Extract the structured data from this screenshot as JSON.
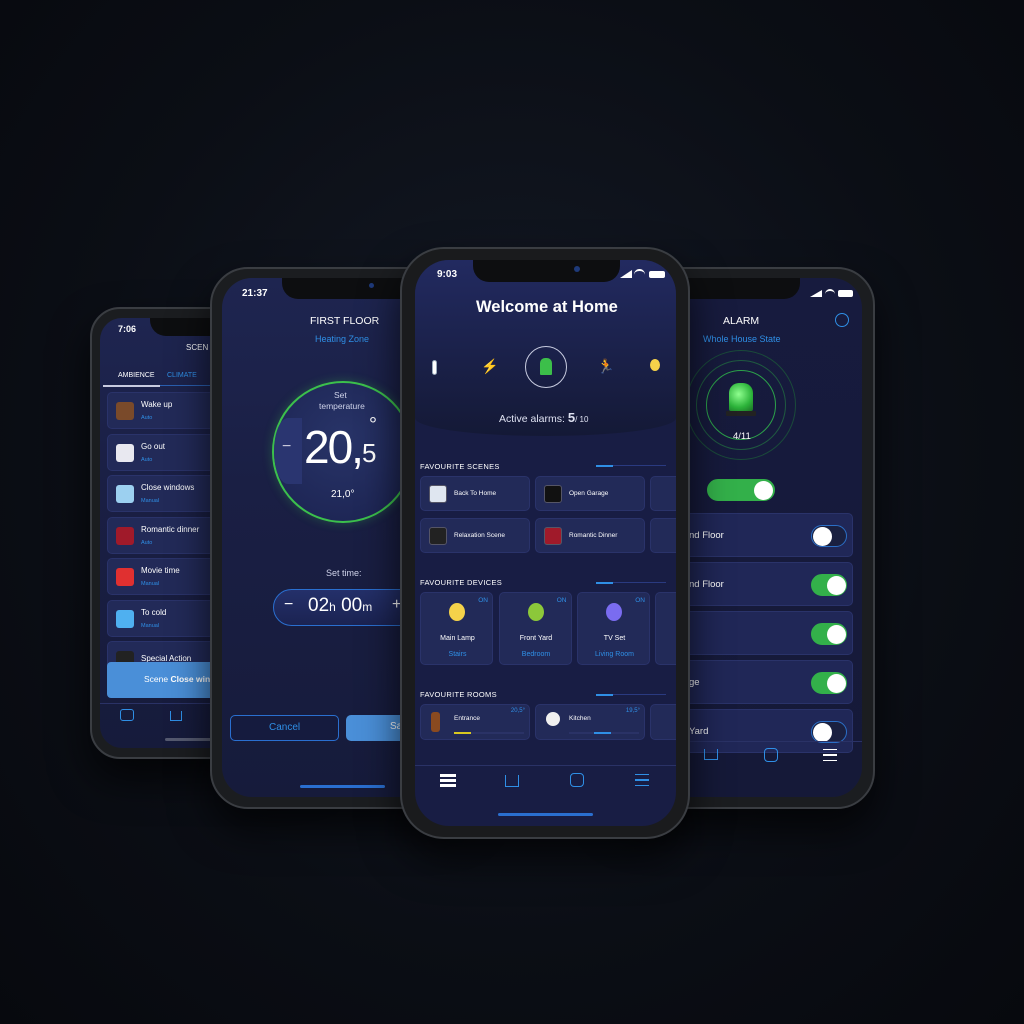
{
  "colors": {
    "accent": "#2f8fe6",
    "green": "#33b04a",
    "background": "#0b0e15",
    "card": "#222a58"
  },
  "phone_scenes": {
    "time": "7:06",
    "title": "SCEN",
    "tabs": [
      {
        "label": "AMBIENCE",
        "active": true
      },
      {
        "label": "CLIMATE",
        "active": false
      }
    ],
    "items": [
      {
        "label": "Wake up",
        "mode": "Auto",
        "icon": "coffee-cup-icon"
      },
      {
        "label": "Go out",
        "mode": "Auto",
        "icon": "exit-door-icon"
      },
      {
        "label": "Close windows",
        "mode": "Manual",
        "icon": "window-icon"
      },
      {
        "label": "Romantic dinner",
        "mode": "Auto",
        "icon": "wine-glasses-icon"
      },
      {
        "label": "Movie time",
        "mode": "Manual",
        "icon": "popcorn-icon"
      },
      {
        "label": "To cold",
        "mode": "Manual",
        "icon": "snowflake-icon"
      },
      {
        "label": "Special Action",
        "mode": "",
        "icon": "clapperboard-icon"
      }
    ],
    "toast": {
      "prefix": "Scene",
      "name": "Close win"
    }
  },
  "phone_thermostat": {
    "time": "21:37",
    "title": "FIRST FLOOR",
    "subtitle": "Heating Zone",
    "set_label_1": "Set",
    "set_label_2": "temperature",
    "temp_int": "20,",
    "temp_dec": "5",
    "degree": "°",
    "minus": "−",
    "current": "21,0°",
    "set_time_label": "Set time:",
    "hours": "02",
    "h_unit": "h",
    "minutes": "00",
    "m_unit": "m",
    "plus": "+",
    "cancel": "Cancel",
    "save": "Sa"
  },
  "phone_home": {
    "time": "9:03",
    "title": "Welcome at Home",
    "categories": [
      "thermometer-icon",
      "lightning-icon",
      "alarm-siren-icon",
      "running-person-icon",
      "light-bulb-icon"
    ],
    "alarms_label": "Active alarms:",
    "alarms_active": "5",
    "alarms_total": "/ 10",
    "scenes_title": "FAVOURITE SCENES",
    "scenes": [
      {
        "label": "Back To Home",
        "icon": "door-enter-icon"
      },
      {
        "label": "Open Garage",
        "icon": "clapperboard-code-icon"
      },
      {
        "label": "Relaxation Scene",
        "icon": "clapperboard-icon"
      },
      {
        "label": "Romantic Dinner",
        "icon": "wine-glasses-icon"
      }
    ],
    "devices_title": "FAVOURITE DEVICES",
    "devices": [
      {
        "name": "Main Lamp",
        "room": "Stairs",
        "state": "ON",
        "icon": "light-bulb-icon"
      },
      {
        "name": "Front Yard",
        "room": "Bedroom",
        "state": "ON",
        "icon": "garden-lamp-icon"
      },
      {
        "name": "TV Set",
        "room": "Living Room",
        "state": "ON",
        "icon": "tv-icon"
      }
    ],
    "rooms_title": "FAVOURITE ROOMS",
    "rooms": [
      {
        "name": "Entrance",
        "temp": "20,5°",
        "icon": "door-icon"
      },
      {
        "name": "Kitchen",
        "temp": "19,5°",
        "icon": "plate-icon"
      }
    ],
    "nav": [
      "scenes-grid-icon",
      "home-icon",
      "play-icon",
      "menu-icon"
    ]
  },
  "phone_alarm": {
    "title": "ALARM",
    "subtitle": "Whole House State",
    "count": "4/11",
    "master_on": true,
    "zones": [
      {
        "label": "nd Floor",
        "on": false
      },
      {
        "label": "nd Floor",
        "on": true
      },
      {
        "label": "",
        "on": true
      },
      {
        "label": "ge",
        "on": true
      },
      {
        "label": "Yard",
        "on": false
      }
    ]
  }
}
